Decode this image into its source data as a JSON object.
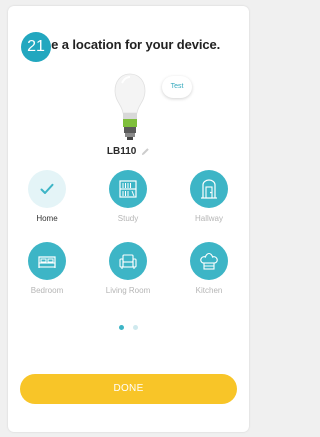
{
  "step_number": "21",
  "title": "se a location for your device.",
  "device": {
    "name": "LB110",
    "test_label": "Test"
  },
  "rooms": [
    {
      "label": "Home",
      "icon": "check-icon",
      "selected": true
    },
    {
      "label": "Study",
      "icon": "bookshelf-icon",
      "selected": false
    },
    {
      "label": "Hallway",
      "icon": "door-icon",
      "selected": false
    },
    {
      "label": "Bedroom",
      "icon": "bed-icon",
      "selected": false
    },
    {
      "label": "Living Room",
      "icon": "armchair-icon",
      "selected": false
    },
    {
      "label": "Kitchen",
      "icon": "chef-hat-icon",
      "selected": false
    }
  ],
  "pagination": {
    "current": 1,
    "total": 2
  },
  "done_label": "DONE",
  "colors": {
    "teal": "#3db5c6",
    "badge": "#22a7bf",
    "done_button": "#f8c528"
  }
}
